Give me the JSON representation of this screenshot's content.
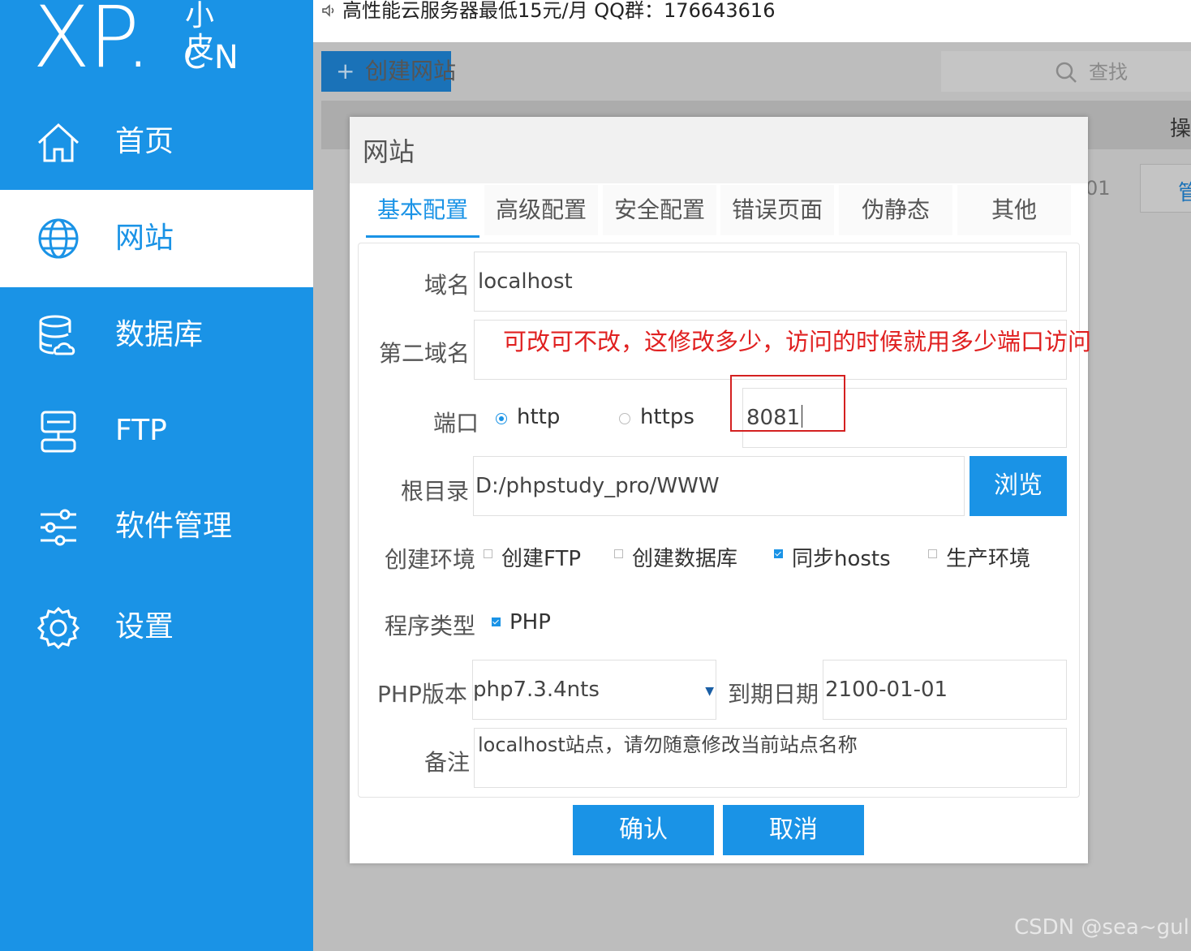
{
  "logo": {
    "main": "XP.",
    "top": "小皮",
    "bottom": "CN"
  },
  "nav": [
    {
      "label": "首页",
      "icon": "home-icon"
    },
    {
      "label": "网站",
      "icon": "globe-icon"
    },
    {
      "label": "数据库",
      "icon": "database-icon"
    },
    {
      "label": "FTP",
      "icon": "ftp-icon"
    },
    {
      "label": "软件管理",
      "icon": "sliders-icon"
    },
    {
      "label": "设置",
      "icon": "gear-icon"
    }
  ],
  "topbar": {
    "notice": "高性能云服务器最低15元/月  QQ群：176643616"
  },
  "toolbar": {
    "create_label": "创建网站",
    "search_label": "查找"
  },
  "table": {
    "op_header": "操",
    "row_fragment": "01",
    "manage_btn": "管"
  },
  "dialog": {
    "title": "网站",
    "tabs": [
      "基本配置",
      "高级配置",
      "安全配置",
      "错误页面",
      "伪静态",
      "其他"
    ],
    "active_tab": "基本配置",
    "domain_label": "域名",
    "domain_value": "localhost",
    "second_domain_label": "第二域名",
    "second_domain_value": "",
    "port_label": "端口",
    "port_http": "http",
    "port_https": "https",
    "port_selected": "http",
    "port_value": "8081",
    "root_label": "根目录",
    "root_value": "D:/phpstudy_pro/WWW",
    "browse_label": "浏览",
    "env_label": "创建环境",
    "env_options": [
      {
        "label": "创建FTP",
        "checked": false
      },
      {
        "label": "创建数据库",
        "checked": false
      },
      {
        "label": "同步hosts",
        "checked": true
      },
      {
        "label": "生产环境",
        "checked": false
      }
    ],
    "prog_label": "程序类型",
    "prog_option": {
      "label": "PHP",
      "checked": true
    },
    "php_label": "PHP版本",
    "php_value": "php7.3.4nts",
    "expire_label": "到期日期",
    "expire_value": "2100-01-01",
    "note_label": "备注",
    "note_value": "localhost站点，请勿随意修改当前站点名称",
    "confirm_label": "确认",
    "cancel_label": "取消"
  },
  "annotation": {
    "text": "可改可不改，这修改多少，访问的时候就用多少端口访问",
    "color": "#e02020"
  },
  "watermark": "CSDN @sea~gull",
  "colors": {
    "accent": "#1a93e6",
    "sidebar": "#1a93e6"
  }
}
